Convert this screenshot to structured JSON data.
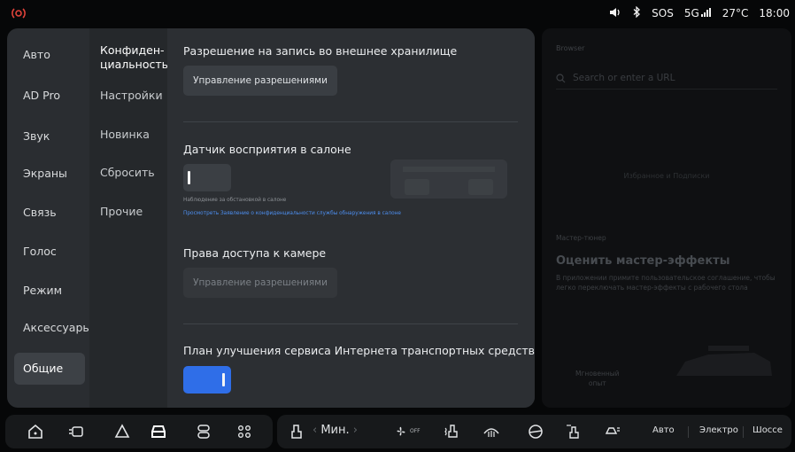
{
  "status_bar": {
    "alert_icon": "radar-alert-icon",
    "alert_color": "#e0433a",
    "icons": [
      "volume-icon",
      "bluetooth-icon"
    ],
    "sos": "SOS",
    "network": "5G",
    "temperature": "27°C",
    "time": "18:00"
  },
  "settings": {
    "nav_primary": [
      {
        "label": "Авто"
      },
      {
        "label": "AD Pro"
      },
      {
        "label": "Звук"
      },
      {
        "label": "Экраны"
      },
      {
        "label": "Связь"
      },
      {
        "label": "Голос"
      },
      {
        "label": "Режим"
      },
      {
        "label": "Аксессуары"
      },
      {
        "label": "Общие",
        "active": true
      }
    ],
    "nav_secondary": [
      {
        "label_line1": "Конфиден-",
        "label_line2": "циальность",
        "active": true
      },
      {
        "label": "Настройки"
      },
      {
        "label": "Новинка"
      },
      {
        "label": "Сбросить"
      },
      {
        "label": "Прочие"
      }
    ],
    "sections": {
      "storage": {
        "title": "Разрешение на запись во внешнее хранилище",
        "button": "Управление разрешениями"
      },
      "sensor": {
        "title": "Датчик восприятия в салоне",
        "toggle_on": false,
        "caption": "Наблюдение за обстановкой в салоне",
        "link": "Просмотреть Заявление о конфиденциальности службы обнаружения в салоне"
      },
      "camera": {
        "title": "Права доступа к камере",
        "button": "Управление разрешениями",
        "button_disabled": true
      },
      "improvement": {
        "title": "План улучшения сервиса Интернета транспортных средств LiAuto",
        "toggle_on": true
      }
    },
    "accent_color": "#2f6ee8"
  },
  "right_panel": {
    "browser_label": "Browser",
    "url_placeholder": "Search or enter a URL",
    "empty_text": "Избранное и Подписки",
    "tuner_label": "Мастер-тюнер",
    "tuner_title": "Оценить мастер-эффекты",
    "tuner_desc": "В приложении примите пользовательское соглашение, чтобы легко переключать мастер-эффекты с рабочего стола",
    "instant_line1": "Мгновенный",
    "instant_line2": "опыт"
  },
  "dock": {
    "left_icons": [
      "home-icon",
      "dashboard-icon",
      "navigation-icon",
      "car-icon",
      "phone-icon",
      "apps-icon"
    ],
    "active_icon": "car-icon",
    "climate": {
      "seat_icon": "seat-icon",
      "temp_label": "Мин.",
      "fan_label": "OFF",
      "icons": [
        "fan-icon",
        "seat-heat-icon",
        "windshield-defrost-icon",
        "steering-heat-icon",
        "seat-vent-icon",
        "rear-defrost-icon"
      ]
    },
    "drive_modes": [
      "Авто",
      "Электро",
      "Шоссе"
    ]
  }
}
